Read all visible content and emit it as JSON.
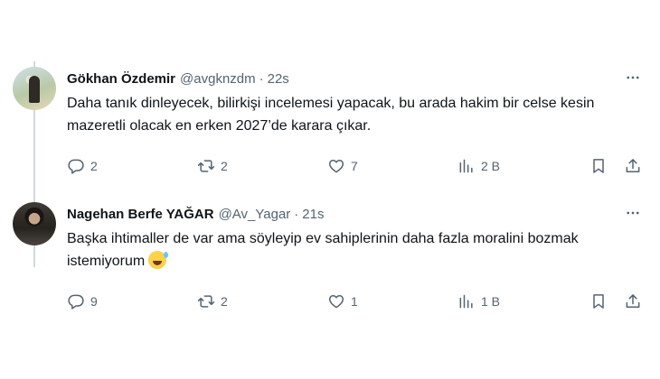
{
  "tweets": [
    {
      "name": "Gökhan Özdemir",
      "handle": "@avgknzdm",
      "separator": "·",
      "time": "22s",
      "text": "Daha tanık dinleyecek, bilirkişi incelemesi yapacak, bu arada hakim bir celse kesin mazeretli olacak en erken 2027’de karara çıkar.",
      "replies": "2",
      "reposts": "2",
      "likes": "7",
      "views": "2 B"
    },
    {
      "name": "Nagehan Berfe YAĞAR",
      "handle": "@Av_Yagar",
      "separator": "·",
      "time": "21s",
      "text": "Başka ihtimaller de var ama söyleyip ev sahiplerinin daha fazla moralini bozmak istemiyorum",
      "emoji": "grinning-sweat-emoji",
      "replies": "9",
      "reposts": "2",
      "likes": "1",
      "views": "1 B"
    }
  ],
  "icons": {
    "reply": "reply-icon",
    "repost": "repost-icon",
    "like": "heart-icon",
    "views": "views-chart-icon",
    "bookmark": "bookmark-icon",
    "share": "share-icon",
    "more": "more-horizontal-icon"
  },
  "colors": {
    "text": "#0f1419",
    "secondary": "#536471",
    "thread_line": "#cfd9de"
  }
}
